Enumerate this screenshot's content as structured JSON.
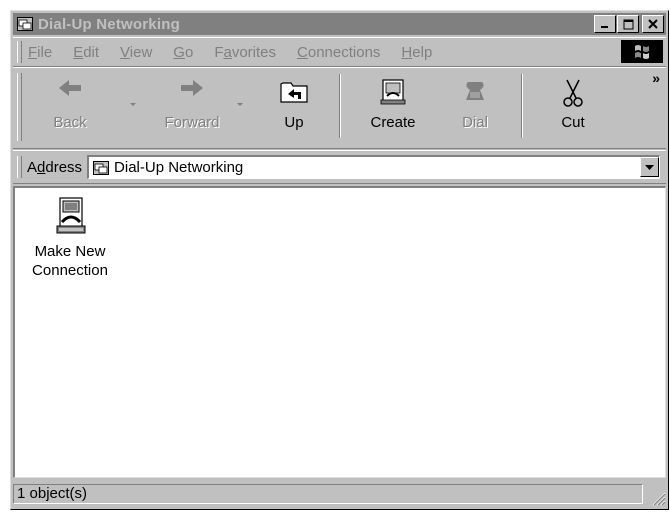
{
  "window": {
    "title": "Dial-Up Networking"
  },
  "menubar": {
    "items": [
      {
        "label": "File",
        "accel": "F",
        "rest": "ile"
      },
      {
        "label": "Edit",
        "accel": "E",
        "rest": "dit"
      },
      {
        "label": "View",
        "accel": "V",
        "rest": "iew"
      },
      {
        "label": "Go",
        "accel": "G",
        "rest": "o"
      },
      {
        "label": "Favorites",
        "pre": "F",
        "accel": "a",
        "rest": "vorites"
      },
      {
        "label": "Connections",
        "accel": "C",
        "rest": "onnections"
      },
      {
        "label": "Help",
        "accel": "H",
        "rest": "elp"
      }
    ]
  },
  "toolbar": {
    "back_label": "Back",
    "forward_label": "Forward",
    "up_label": "Up",
    "create_label": "Create",
    "dial_label": "Dial",
    "cut_label": "Cut",
    "more_label": "»"
  },
  "address": {
    "label_pre": "A",
    "label_accel": "d",
    "label_rest": "dress",
    "value": "Dial-Up Networking"
  },
  "content": {
    "items": [
      {
        "label_line1": "Make New",
        "label_line2": "Connection",
        "icon": "make-new-connection-icon"
      }
    ]
  },
  "status": {
    "text": "1 object(s)"
  },
  "colors": {
    "face": "#c0c0c0",
    "shadow": "#808080",
    "highlight": "#ffffff",
    "inactive_title": "#808080"
  }
}
